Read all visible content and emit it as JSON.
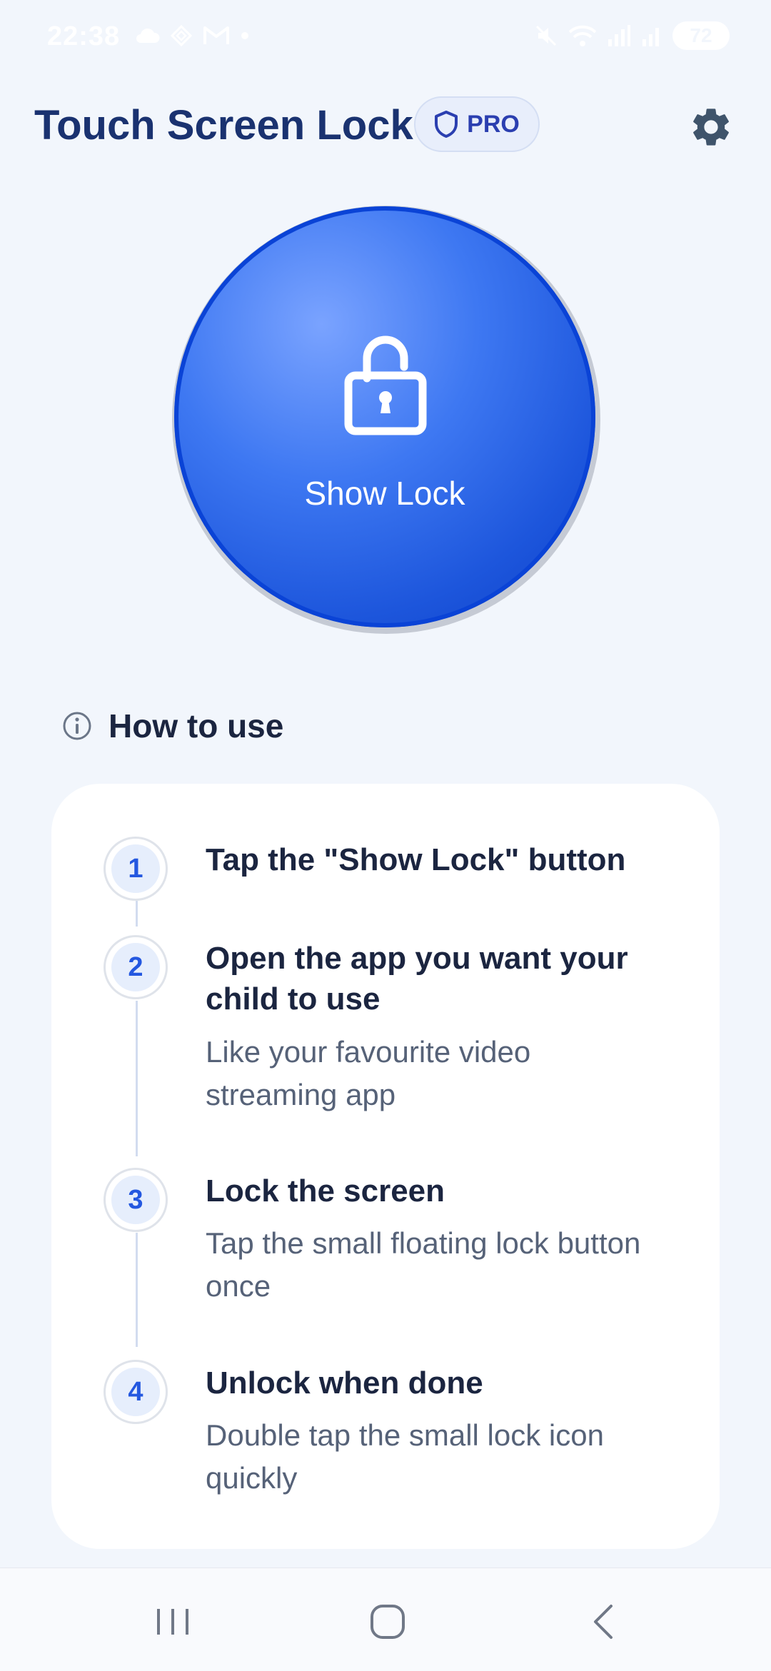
{
  "status_bar": {
    "time": "22:38",
    "battery": "72"
  },
  "header": {
    "title": "Touch Screen Lock",
    "badge_label": "PRO"
  },
  "lock_button": {
    "label": "Show Lock"
  },
  "how_to_use": {
    "title": "How to use",
    "steps": [
      {
        "number": "1",
        "title": "Tap the \"Show Lock\" button",
        "description": ""
      },
      {
        "number": "2",
        "title": "Open the app you want your child to use",
        "description": "Like your favourite video streaming app"
      },
      {
        "number": "3",
        "title": "Lock the screen",
        "description": "Tap the small floating lock button once"
      },
      {
        "number": "4",
        "title": "Unlock when done",
        "description": "Double tap the small lock icon quickly"
      }
    ]
  },
  "icons": {
    "badge": "shield-icon",
    "settings": "gear-icon",
    "lock": "lock-open-icon",
    "info": "info-icon",
    "nav": [
      "recent-apps-icon",
      "home-icon",
      "back-icon"
    ]
  },
  "colors": {
    "accent": "#2458e0",
    "title": "#1a3270",
    "background": "#f2f6fc"
  }
}
